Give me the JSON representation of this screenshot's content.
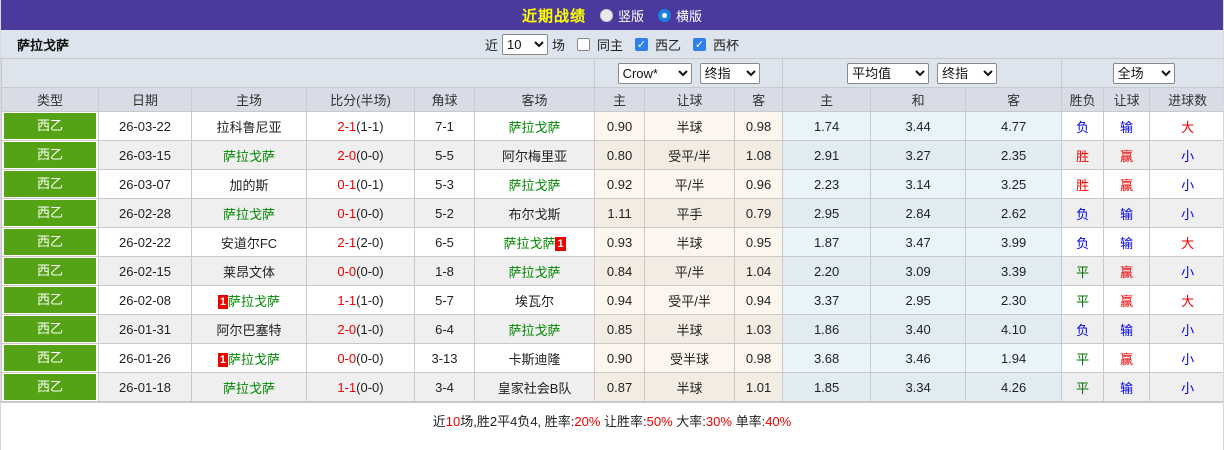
{
  "colors": {
    "title_bar_bg": "#4a3a9e",
    "title_text": "#ffff00",
    "league_badge_bg": "#55a314",
    "team_highlight": "#008800",
    "outcome": {
      "red": "#ee0000",
      "blue": "#0000ee",
      "green": "#007000"
    }
  },
  "title_bar": {
    "title": "近期战绩",
    "radio_vertical_label": "竖版",
    "radio_horizontal_label": "横版",
    "selected_layout": "横版"
  },
  "control_bar": {
    "team_name": "萨拉戈萨",
    "near_label": "近",
    "match_count_value": "10",
    "matches_label": "场",
    "same_home_label": "同主",
    "same_home_checked": false,
    "league_filter_label": "西乙",
    "league_filter_checked": true,
    "cup_filter_label": "西杯",
    "cup_filter_checked": true,
    "check_glyph": "✓"
  },
  "filter_row": {
    "company_value": "Crow*",
    "asian_index_value": "终指",
    "average_value": "平均值",
    "euro_index_value": "终指",
    "scope_value": "全场"
  },
  "table": {
    "columns": [
      "类型",
      "日期",
      "主场",
      "比分(半场)",
      "角球",
      "客场",
      "主",
      "让球",
      "客",
      "主",
      "和",
      "客",
      "胜负",
      "让球",
      "进球数"
    ],
    "rows": [
      {
        "league": "西乙",
        "date": "26-03-22",
        "home": {
          "name": "拉科鲁尼亚",
          "green": false,
          "badge": "",
          "badge_pos": ""
        },
        "score": "2-1",
        "half": "(1-1)",
        "corner": "7-1",
        "away": {
          "name": "萨拉戈萨",
          "green": true,
          "badge": "",
          "badge_pos": ""
        },
        "asian": [
          "0.90",
          "半球",
          "0.98"
        ],
        "euro": [
          "1.74",
          "3.44",
          "4.77"
        ],
        "outcome": [
          [
            "负",
            "blue"
          ],
          [
            "输",
            "blue"
          ],
          [
            "大",
            "red"
          ]
        ]
      },
      {
        "league": "西乙",
        "date": "26-03-15",
        "home": {
          "name": "萨拉戈萨",
          "green": true,
          "badge": "",
          "badge_pos": ""
        },
        "score": "2-0",
        "half": "(0-0)",
        "corner": "5-5",
        "away": {
          "name": "阿尔梅里亚",
          "green": false,
          "badge": "",
          "badge_pos": ""
        },
        "asian": [
          "0.80",
          "受平/半",
          "1.08"
        ],
        "euro": [
          "2.91",
          "3.27",
          "2.35"
        ],
        "outcome": [
          [
            "胜",
            "red"
          ],
          [
            "赢",
            "red"
          ],
          [
            "小",
            "blue"
          ]
        ]
      },
      {
        "league": "西乙",
        "date": "26-03-07",
        "home": {
          "name": "加的斯",
          "green": false,
          "badge": "",
          "badge_pos": ""
        },
        "score": "0-1",
        "half": "(0-1)",
        "corner": "5-3",
        "away": {
          "name": "萨拉戈萨",
          "green": true,
          "badge": "",
          "badge_pos": ""
        },
        "asian": [
          "0.92",
          "平/半",
          "0.96"
        ],
        "euro": [
          "2.23",
          "3.14",
          "3.25"
        ],
        "outcome": [
          [
            "胜",
            "red"
          ],
          [
            "赢",
            "red"
          ],
          [
            "小",
            "blue"
          ]
        ]
      },
      {
        "league": "西乙",
        "date": "26-02-28",
        "home": {
          "name": "萨拉戈萨",
          "green": true,
          "badge": "",
          "badge_pos": ""
        },
        "score": "0-1",
        "half": "(0-0)",
        "corner": "5-2",
        "away": {
          "name": "布尔戈斯",
          "green": false,
          "badge": "",
          "badge_pos": ""
        },
        "asian": [
          "1.11",
          "平手",
          "0.79"
        ],
        "euro": [
          "2.95",
          "2.84",
          "2.62"
        ],
        "outcome": [
          [
            "负",
            "blue"
          ],
          [
            "输",
            "blue"
          ],
          [
            "小",
            "blue"
          ]
        ]
      },
      {
        "league": "西乙",
        "date": "26-02-22",
        "home": {
          "name": "安道尔FC",
          "green": false,
          "badge": "",
          "badge_pos": ""
        },
        "score": "2-1",
        "half": "(2-0)",
        "corner": "6-5",
        "away": {
          "name": "萨拉戈萨",
          "green": true,
          "badge": "1",
          "badge_pos": "after"
        },
        "asian": [
          "0.93",
          "半球",
          "0.95"
        ],
        "euro": [
          "1.87",
          "3.47",
          "3.99"
        ],
        "outcome": [
          [
            "负",
            "blue"
          ],
          [
            "输",
            "blue"
          ],
          [
            "大",
            "red"
          ]
        ]
      },
      {
        "league": "西乙",
        "date": "26-02-15",
        "home": {
          "name": "莱昂文体",
          "green": false,
          "badge": "",
          "badge_pos": ""
        },
        "score": "0-0",
        "half": "(0-0)",
        "corner": "1-8",
        "away": {
          "name": "萨拉戈萨",
          "green": true,
          "badge": "",
          "badge_pos": ""
        },
        "asian": [
          "0.84",
          "平/半",
          "1.04"
        ],
        "euro": [
          "2.20",
          "3.09",
          "3.39"
        ],
        "outcome": [
          [
            "平",
            "green"
          ],
          [
            "赢",
            "red"
          ],
          [
            "小",
            "blue"
          ]
        ]
      },
      {
        "league": "西乙",
        "date": "26-02-08",
        "home": {
          "name": "萨拉戈萨",
          "green": true,
          "badge": "1",
          "badge_pos": "before"
        },
        "score": "1-1",
        "half": "(1-0)",
        "corner": "5-7",
        "away": {
          "name": "埃瓦尔",
          "green": false,
          "badge": "",
          "badge_pos": ""
        },
        "asian": [
          "0.94",
          "受平/半",
          "0.94"
        ],
        "euro": [
          "3.37",
          "2.95",
          "2.30"
        ],
        "outcome": [
          [
            "平",
            "green"
          ],
          [
            "赢",
            "red"
          ],
          [
            "大",
            "red"
          ]
        ]
      },
      {
        "league": "西乙",
        "date": "26-01-31",
        "home": {
          "name": "阿尔巴塞特",
          "green": false,
          "badge": "",
          "badge_pos": ""
        },
        "score": "2-0",
        "half": "(1-0)",
        "corner": "6-4",
        "away": {
          "name": "萨拉戈萨",
          "green": true,
          "badge": "",
          "badge_pos": ""
        },
        "asian": [
          "0.85",
          "半球",
          "1.03"
        ],
        "euro": [
          "1.86",
          "3.40",
          "4.10"
        ],
        "outcome": [
          [
            "负",
            "blue"
          ],
          [
            "输",
            "blue"
          ],
          [
            "小",
            "blue"
          ]
        ]
      },
      {
        "league": "西乙",
        "date": "26-01-26",
        "home": {
          "name": "萨拉戈萨",
          "green": true,
          "badge": "1",
          "badge_pos": "before"
        },
        "score": "0-0",
        "half": "(0-0)",
        "corner": "3-13",
        "away": {
          "name": "卡斯迪隆",
          "green": false,
          "badge": "",
          "badge_pos": ""
        },
        "asian": [
          "0.90",
          "受半球",
          "0.98"
        ],
        "euro": [
          "3.68",
          "3.46",
          "1.94"
        ],
        "outcome": [
          [
            "平",
            "green"
          ],
          [
            "赢",
            "red"
          ],
          [
            "小",
            "blue"
          ]
        ]
      },
      {
        "league": "西乙",
        "date": "26-01-18",
        "home": {
          "name": "萨拉戈萨",
          "green": true,
          "badge": "",
          "badge_pos": ""
        },
        "score": "1-1",
        "half": "(0-0)",
        "corner": "3-4",
        "away": {
          "name": "皇家社会B队",
          "green": false,
          "badge": "",
          "badge_pos": ""
        },
        "asian": [
          "0.87",
          "半球",
          "1.01"
        ],
        "euro": [
          "1.85",
          "3.34",
          "4.26"
        ],
        "outcome": [
          [
            "平",
            "green"
          ],
          [
            "输",
            "blue"
          ],
          [
            "小",
            "blue"
          ]
        ]
      }
    ]
  },
  "footer": {
    "segments": [
      {
        "text": "近",
        "color": "k"
      },
      {
        "text": "10",
        "color": "r"
      },
      {
        "text": "场,胜2平4负4, 胜率:",
        "color": "k"
      },
      {
        "text": "20%",
        "color": "r"
      },
      {
        "text": " 让胜率:",
        "color": "k"
      },
      {
        "text": "50%",
        "color": "r"
      },
      {
        "text": " 大率:",
        "color": "k"
      },
      {
        "text": "30%",
        "color": "r"
      },
      {
        "text": " 单率:",
        "color": "k"
      },
      {
        "text": "40%",
        "color": "r"
      }
    ]
  }
}
